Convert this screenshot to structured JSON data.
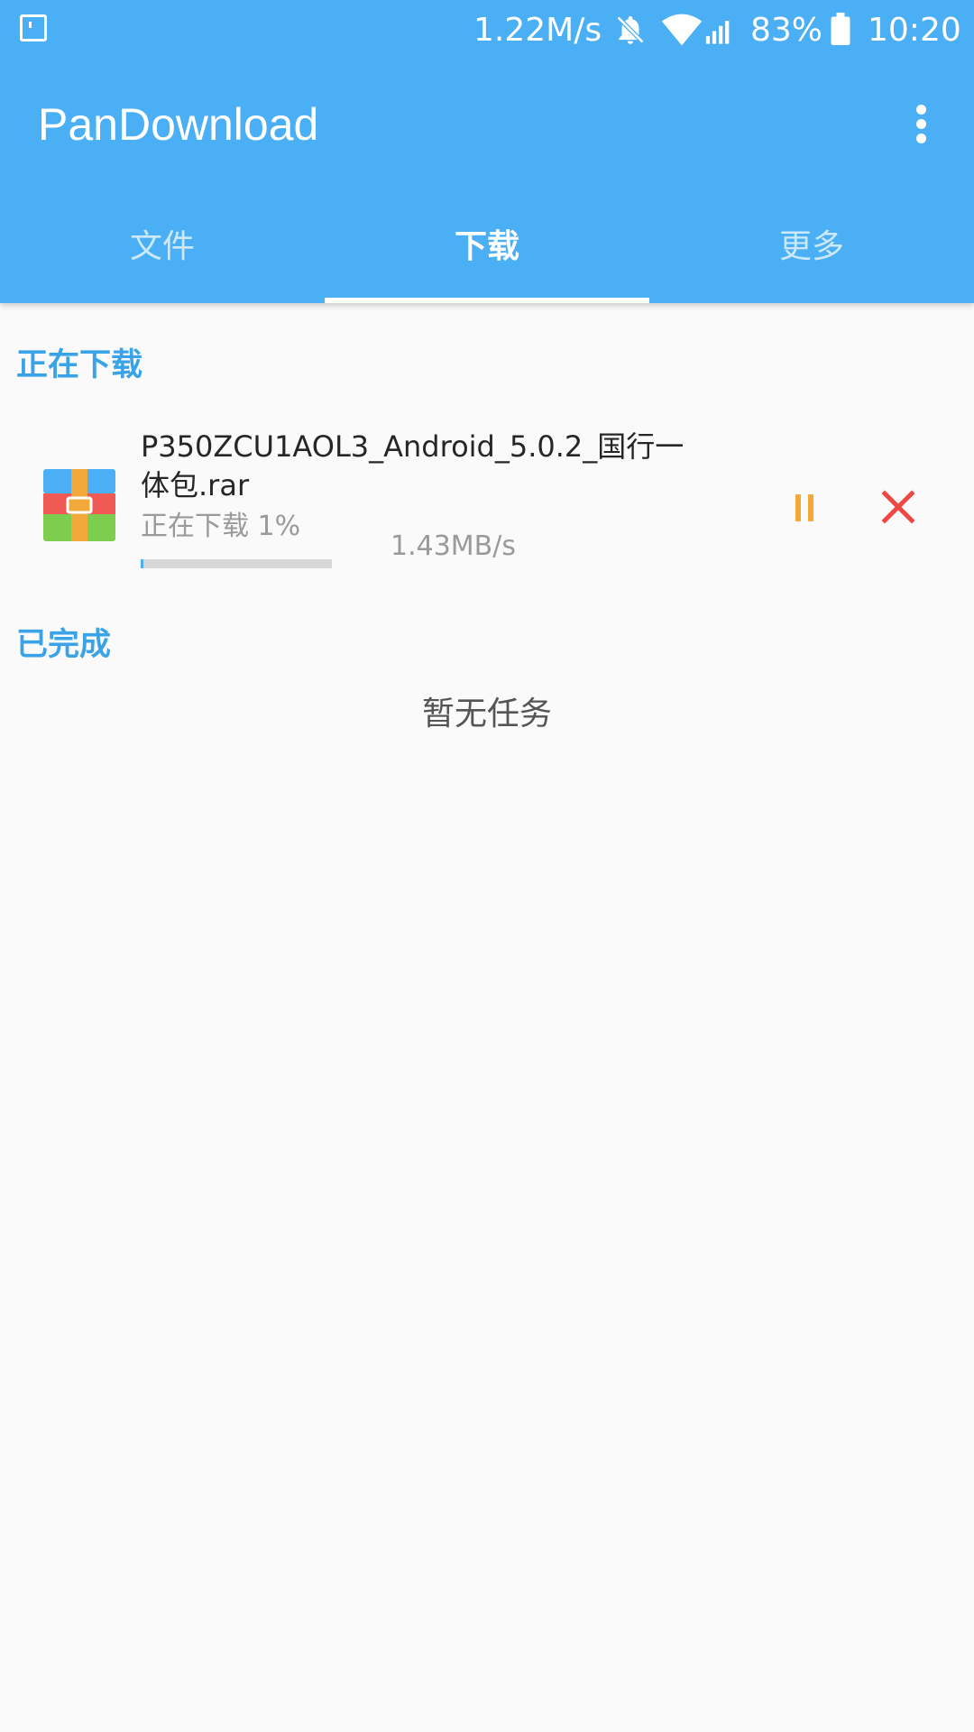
{
  "status_bar": {
    "network_speed": "1.22M/s",
    "battery_percent": "83%",
    "time": "10:20",
    "icons": [
      "screen-icon",
      "bell-off-icon",
      "wifi-icon",
      "signal-icon",
      "battery-icon"
    ]
  },
  "toolbar": {
    "title": "PanDownload",
    "menu_icon": "more-vert-icon"
  },
  "tabs": [
    {
      "label": "文件",
      "active": false
    },
    {
      "label": "下载",
      "active": true
    },
    {
      "label": "更多",
      "active": false
    }
  ],
  "sections": {
    "downloading": {
      "title": "正在下载",
      "items": [
        {
          "file_name": "P350ZCU1AOL3_Android_5.0.2_国行一体包.rar",
          "status": "正在下载 1%",
          "progress_fraction": 0.01,
          "speed": "1.43MB/s",
          "icon": "archive-file-icon",
          "actions": [
            "pause-icon",
            "close-icon"
          ]
        }
      ]
    },
    "completed": {
      "title": "已完成",
      "empty_text": "暂无任务"
    }
  },
  "colors": {
    "primary": "#4aaff4",
    "section_header": "#3aa3e8",
    "pause": "#f3a93a",
    "cancel": "#ef4744",
    "background": "#fafafa"
  }
}
